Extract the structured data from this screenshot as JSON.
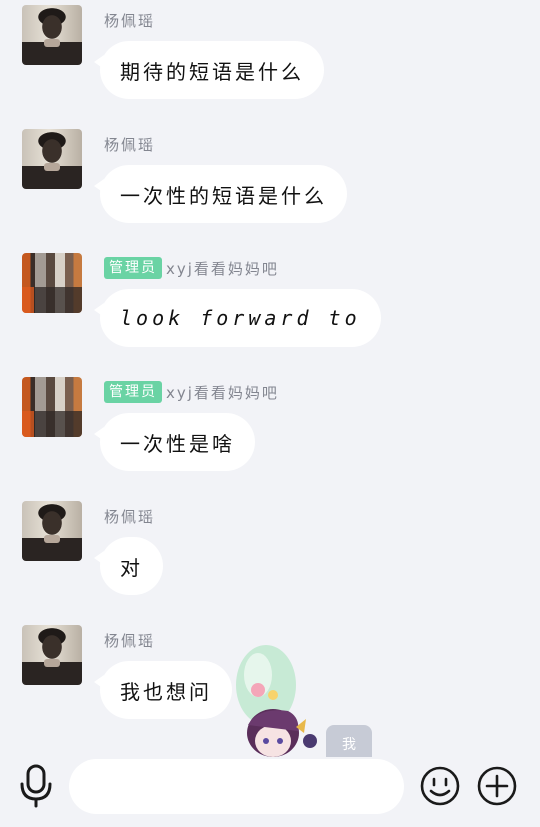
{
  "messages": [
    {
      "avatar": "woman-portrait-avatar",
      "badge": "",
      "name": "杨佩瑶",
      "text": "期待的短语是什么"
    },
    {
      "avatar": "woman-portrait-avatar",
      "badge": "",
      "name": "杨佩瑶",
      "text": "一次性的短语是什么"
    },
    {
      "avatar": "street-scene-avatar",
      "badge": "管理员",
      "name": "xyj看看妈妈吧",
      "text": "look forward to"
    },
    {
      "avatar": "street-scene-avatar",
      "badge": "管理员",
      "name": "xyj看看妈妈吧",
      "text": "一次性是啥"
    },
    {
      "avatar": "woman-portrait-avatar",
      "badge": "",
      "name": "杨佩瑶",
      "text": "对"
    },
    {
      "avatar": "woman-portrait-avatar",
      "badge": "",
      "name": "杨佩瑶",
      "text": "我也想问"
    }
  ],
  "sticker": {
    "name": "anime-girl-sticker",
    "label": "我"
  },
  "bottom_bar": {
    "input_value": "",
    "icons": [
      "microphone-icon",
      "emoji-icon",
      "plus-icon"
    ]
  },
  "colors": {
    "background": "#f2f3f7",
    "bubble": "#ffffff",
    "badge": "#6ad3a4",
    "name": "#838690"
  }
}
